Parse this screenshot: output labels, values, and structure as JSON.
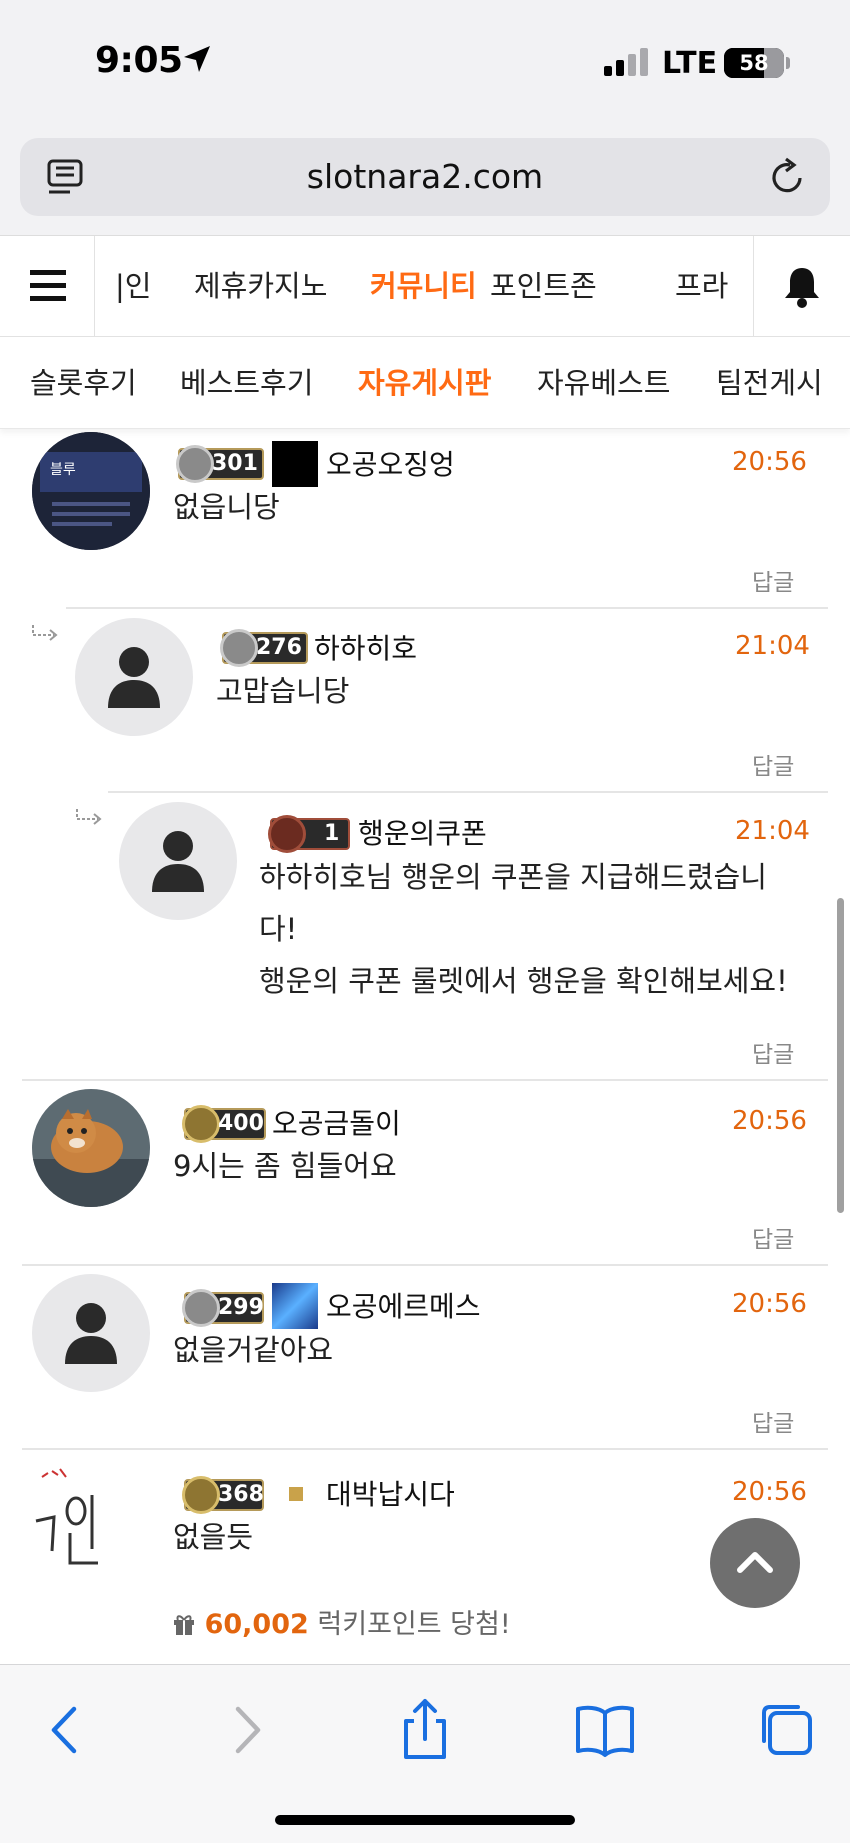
{
  "status_bar": {
    "time": "9:05",
    "network": "LTE",
    "battery": "58"
  },
  "browser": {
    "url": "slotnara2.com"
  },
  "nav_main": {
    "items": [
      "|인",
      "제휴카지노",
      "커뮤니티",
      "포인트존",
      "프라"
    ],
    "active": "커뮤니티"
  },
  "nav_sub": {
    "items": [
      "슬롯후기",
      "베스트후기",
      "자유게시판",
      "자유베스트",
      "팀전게시"
    ],
    "active": "자유게시판"
  },
  "comments": [
    {
      "level": "301",
      "name": "오공오징엉",
      "time": "20:56",
      "text": "없읍니당",
      "reply_label": "답글"
    },
    {
      "level": "276",
      "name": "하하히호",
      "time": "21:04",
      "text": "고맙습니당",
      "reply_label": "답글"
    },
    {
      "level": "1",
      "name": "행운의쿠폰",
      "time": "21:04",
      "text_lines": [
        "하하히호님 행운의 쿠폰을 지급해드렸습니",
        "다!",
        "행운의 쿠폰 룰렛에서 행운을 확인해보세요!"
      ],
      "reply_label": "답글"
    },
    {
      "level": "400",
      "name": "오공금돌이",
      "time": "20:56",
      "text": "9시는 좀 힘들어요",
      "reply_label": "답글"
    },
    {
      "level": "299",
      "name": "오공에르메스",
      "time": "20:56",
      "text": "없을거같아요",
      "reply_label": "답글"
    },
    {
      "level": "368",
      "name": "대박납시다",
      "time": "20:56",
      "text": "없을듯",
      "lucky_amount": "60,002",
      "lucky_text": "럭키포인트 당첨!"
    }
  ],
  "colors": {
    "accent": "#ff6a13",
    "time": "#e2650e"
  }
}
